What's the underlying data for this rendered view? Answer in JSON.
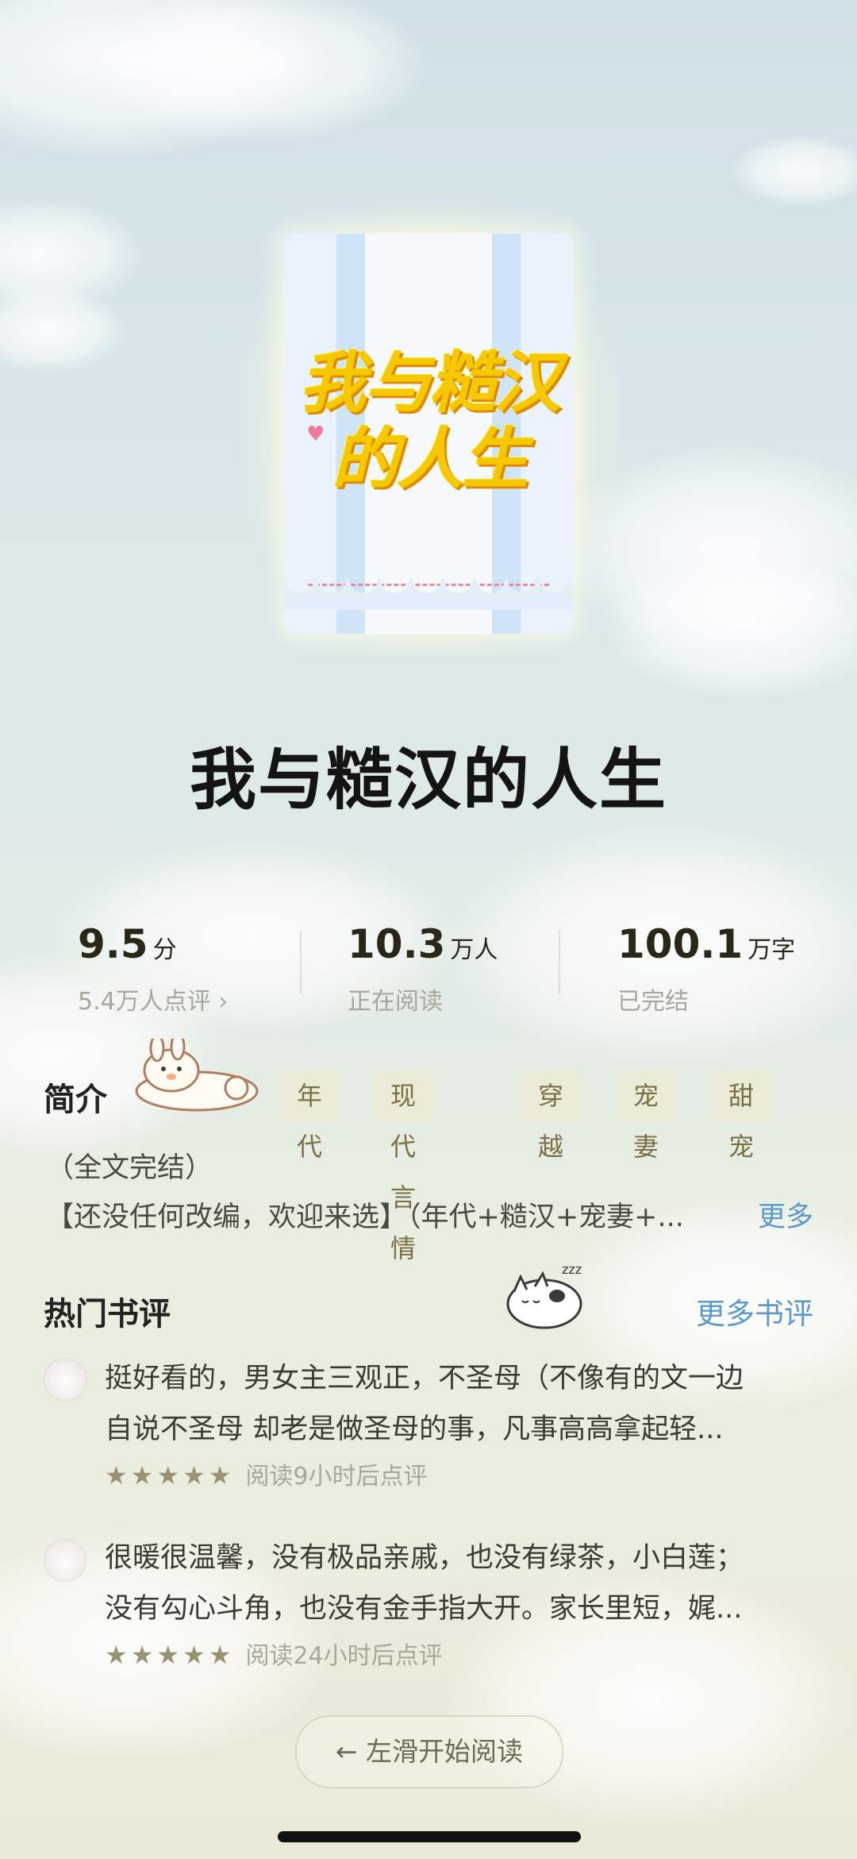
{
  "book": {
    "cover_title_line1": "我与糙汉",
    "cover_title_line2": "的人生",
    "title": "我与糙汉的人生"
  },
  "stats": [
    {
      "value": "9.5",
      "unit": "分",
      "sub": "5.4万人点评 ›"
    },
    {
      "value": "10.3",
      "unit": "万人",
      "sub": "正在阅读"
    },
    {
      "value": "100.1",
      "unit": "万字",
      "sub": "已完结"
    }
  ],
  "intro": {
    "label": "简介",
    "tags": [
      "年代",
      "现代言情",
      "穿越",
      "宠妻",
      "甜宠"
    ],
    "line1": "（全文完结）",
    "line2": "【还没任何改编，欢迎来选】（年代+糙汉+宠妻+...",
    "more": "更多"
  },
  "reviews_section": {
    "label": "热门书评",
    "more": "更多书评"
  },
  "reviews": [
    {
      "line1": "挺好看的，男女主三观正，不圣母（不像有的文一边",
      "line2": "自说不圣母 却老是做圣母的事，凡事高高拿起轻...",
      "stars": "★★★★★",
      "meta": "阅读9小时后点评"
    },
    {
      "line1": "很暖很温馨，没有极品亲戚，也没有绿茶，小白莲；",
      "line2": "没有勾心斗角，也没有金手指大开。家长里短，娓...",
      "stars": "★★★★★",
      "meta": "阅读24小时后点评"
    }
  ],
  "start_button": "← 左滑开始阅读",
  "colors": {
    "accent_link": "#5b99c9",
    "cover_title": "#f5c800",
    "tag_text": "#7c6f45"
  }
}
